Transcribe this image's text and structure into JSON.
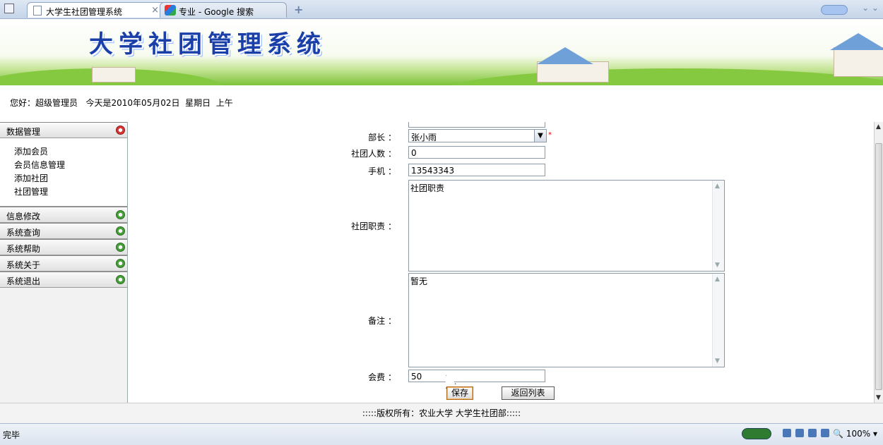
{
  "browser": {
    "tabs": [
      {
        "label": "大学生社团管理系统",
        "close": "×"
      },
      {
        "label": "专业 - Google 搜索"
      }
    ],
    "new_tab": "+"
  },
  "banner": {
    "title": "大学社团管理系统"
  },
  "greeting": "您好：超级管理员   今天是2010年05月02日  星期日  上午",
  "sidebar": {
    "sections": [
      {
        "label": "数据管理",
        "expanded": true,
        "items": [
          "添加会员",
          "会员信息管理",
          "添加社团",
          "社团管理"
        ]
      },
      {
        "label": "信息修改"
      },
      {
        "label": "系统查询"
      },
      {
        "label": "系统帮助"
      },
      {
        "label": "系统关于"
      },
      {
        "label": "系统退出"
      }
    ]
  },
  "form": {
    "minister_label": "部长 ：",
    "minister_value": "张小雨",
    "required_mark": "*",
    "member_count_label": "社团人数 ：",
    "member_count_value": "0",
    "phone_label": "手机 ：",
    "phone_value": "13543343",
    "duty_label": "社团职责 ：",
    "duty_value": "社团职责",
    "remark_label": "备注 ：",
    "remark_value": "暂无",
    "fee_label": "会费 ：",
    "fee_value": "50",
    "save_label": "保存",
    "back_label": "返回列表"
  },
  "footer": ":::::版权所有：农业大学 大学生社团部:::::",
  "statusbar": {
    "status": "完毕",
    "zoom": "100%"
  }
}
